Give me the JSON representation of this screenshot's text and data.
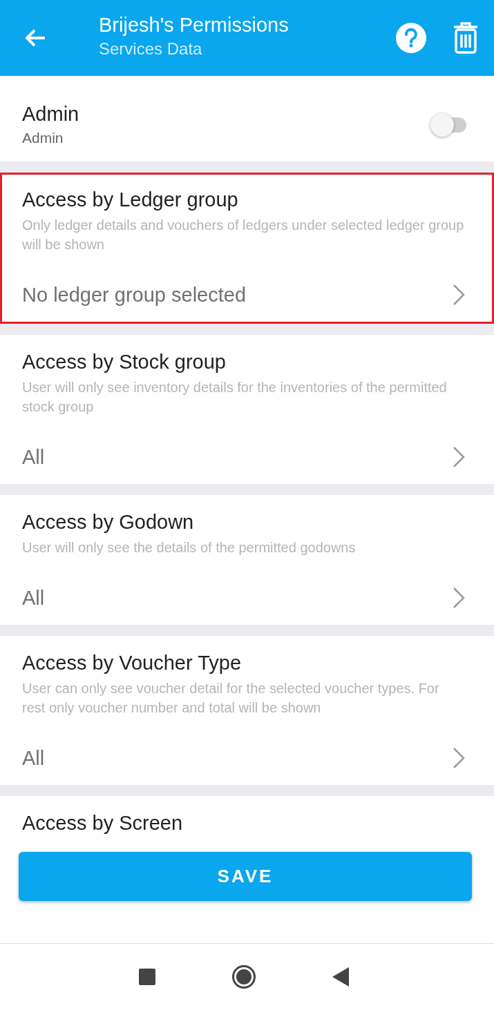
{
  "header": {
    "title": "Brijesh's Permissions",
    "subtitle": "Services Data"
  },
  "admin": {
    "title": "Admin",
    "subtitle": "Admin",
    "on": false
  },
  "sections": [
    {
      "title": "Access by Ledger group",
      "description": "Only ledger details and vouchers of ledgers under selected ledger group will be shown",
      "value": "No ledger group selected",
      "highlighted": true
    },
    {
      "title": "Access by Stock group",
      "description": "User will only see inventory details for the inventories of the permitted stock group",
      "value": "All",
      "highlighted": false
    },
    {
      "title": "Access by Godown",
      "description": "User will only see the details of the permitted godowns",
      "value": "All",
      "highlighted": false
    },
    {
      "title": "Access by Voucher Type",
      "description": "User can only see voucher detail for the selected voucher types. For rest only voucher number and total will be shown",
      "value": "All",
      "highlighted": false
    }
  ],
  "partial_section": {
    "title": "Access by Screen"
  },
  "save_button": "SAVE"
}
